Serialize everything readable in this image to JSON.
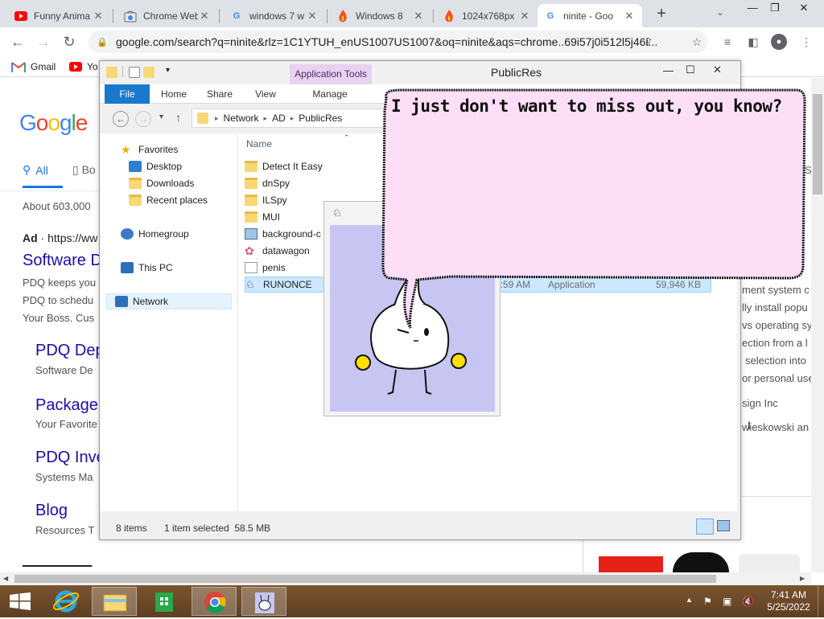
{
  "browser": {
    "tabs": [
      {
        "title": "Funny Anima",
        "favicon": "youtube-icon",
        "color": "#ff0000"
      },
      {
        "title": "Chrome Web",
        "favicon": "chrome-webstore-icon",
        "color": "#ea4335"
      },
      {
        "title": "windows 7 w",
        "favicon": "google-icon",
        "color": "#4285f4"
      },
      {
        "title": "Windows 8",
        "favicon": "flame-icon",
        "color": "#f4511e"
      },
      {
        "title": "1024x768px",
        "favicon": "flame-icon",
        "color": "#f4511e"
      },
      {
        "title": "ninite - Goo",
        "favicon": "google-icon",
        "color": "#4285f4"
      }
    ],
    "new_tab": "+",
    "url": "google.com/search?q=ninite&rlz=1C1YTUH_enUS1007US1007&oq=ninite&aqs=chrome..69i57j0i512l5j46i...",
    "bookmarks": [
      {
        "label": "Gmail",
        "icon": "gmail-icon"
      },
      {
        "label": "Yo",
        "icon": "youtube-icon"
      }
    ]
  },
  "google": {
    "logo": "Google",
    "tabs": {
      "all": "All",
      "books": "Bo"
    },
    "results_count": "About 603,000",
    "ad_label": "Ad",
    "ad_url": "https://ww",
    "ad_title": "Software D",
    "ad_desc": [
      "PDQ keeps you",
      "PDQ to schedu",
      "Your Boss. Cus"
    ],
    "sitelinks": [
      {
        "title": "PDQ Dep",
        "desc": "Software De"
      },
      {
        "title": "Package",
        "desc": "Your Favorite"
      },
      {
        "title": "PDQ Inve",
        "desc": "Systems Ma"
      },
      {
        "title": "Blog",
        "desc": "Resources T"
      }
    ],
    "right_fragments": [
      "ment system c",
      "lly install popu",
      "vs operating sy",
      "ection from a l",
      "selection into",
      "or personal use",
      "sign Inc",
      "wieskowski an"
    ],
    "right_tab_fragment": "S"
  },
  "explorer": {
    "title": "PublicRes",
    "app_tools": "Application Tools",
    "ribbon_tabs": [
      "File",
      "Home",
      "Share",
      "View",
      "Manage"
    ],
    "breadcrumb": [
      "Network",
      "AD",
      "PublicRes"
    ],
    "nav": {
      "favorites": "Favorites",
      "desktop": "Desktop",
      "downloads": "Downloads",
      "recent": "Recent places",
      "homegroup": "Homegroup",
      "thispc": "This PC",
      "network": "Network"
    },
    "column_name": "Name",
    "files": [
      {
        "name": "Detect It Easy",
        "icon": "folder-icon"
      },
      {
        "name": "dnSpy",
        "icon": "folder-icon"
      },
      {
        "name": "ILSpy",
        "icon": "folder-icon"
      },
      {
        "name": "MUI",
        "icon": "folder-icon"
      },
      {
        "name": "background-c",
        "icon": "image-file-icon"
      },
      {
        "name": "datawagon",
        "icon": "gear-file-icon"
      },
      {
        "name": "penis",
        "icon": "text-file-icon"
      },
      {
        "name": "RUNONCE",
        "icon": "app-icon",
        "modified": "7:59 AM",
        "type": "Application",
        "size": "59,946 KB"
      }
    ],
    "status_items": "8 items",
    "status_selected": "1 item selected  58.5 MB"
  },
  "bubble": {
    "text": "I just don't want to miss out, you know?"
  },
  "taskbar": {
    "time": "7:41 AM",
    "date": "5/25/2022"
  }
}
